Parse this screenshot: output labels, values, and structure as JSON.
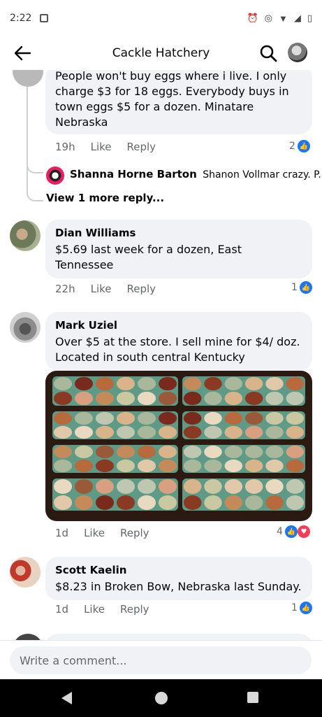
{
  "status_bar": {
    "time": "2:22",
    "icons": [
      "notification-icon",
      "alarm-icon",
      "data-saver-icon",
      "wifi-icon",
      "signal-icon",
      "battery-icon"
    ]
  },
  "header": {
    "title": "Cackle Hatchery",
    "icons": [
      "back-arrow-icon",
      "search-icon",
      "profile-avatar"
    ]
  },
  "comments": [
    {
      "text": "People won't buy eggs where i live. I only charge $3 for 18 eggs. Everybody buys in town eggs $5 for a dozen. Minatare Nebraska",
      "time": "19h",
      "like_label": "Like",
      "reply_label": "Reply",
      "reaction_count": "2"
    },
    {
      "author": "Dian Williams",
      "text": "$5.69 last week for a dozen, East Tennessee",
      "time": "22h",
      "like_label": "Like",
      "reply_label": "Reply",
      "reaction_count": "1"
    },
    {
      "author": "Mark Uziel",
      "text": "Over $5 at the store.  I sell mine for $4/ doz.  Located in south central Kentucky",
      "time": "1d",
      "like_label": "Like",
      "reply_label": "Reply",
      "reaction_count": "4"
    },
    {
      "author": "Scott Kaelin",
      "text": "$8.23 in Broken Bow, Nebraska last Sunday.",
      "time": "1d",
      "like_label": "Like",
      "reply_label": "Reply",
      "reaction_count": "1"
    }
  ],
  "reply_preview": {
    "author": "Shanna Horne Barton",
    "text": "Shanon Vollmar crazy. P..."
  },
  "view_more": "View 1 more reply...",
  "composer": {
    "placeholder": "Write a comment..."
  },
  "colors": {
    "like_blue": "#1877f2",
    "love_red": "#f33e58",
    "bubble_bg": "#f0f2f5"
  }
}
